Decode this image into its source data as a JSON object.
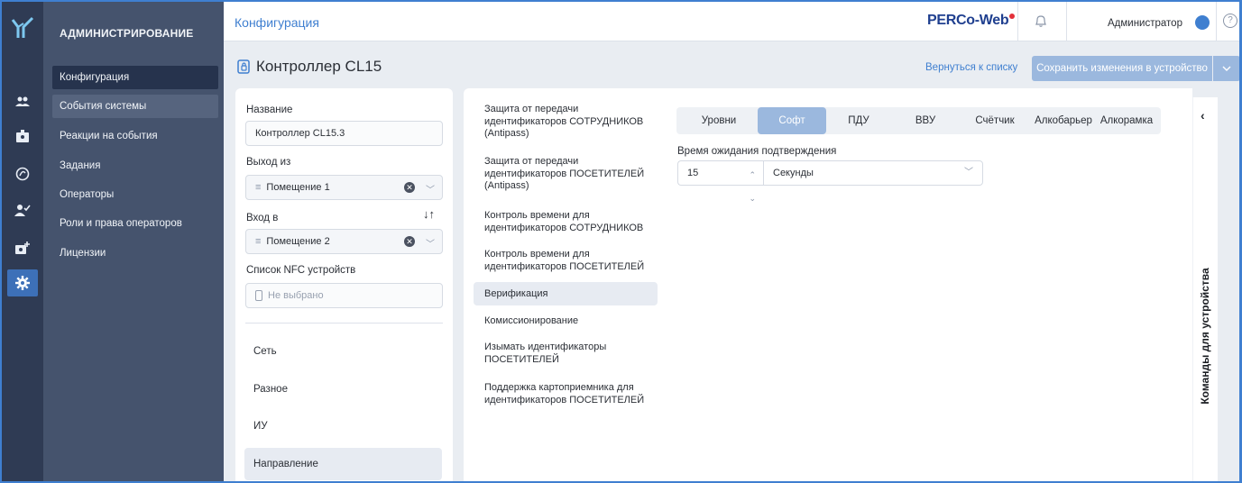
{
  "nav": {
    "section_title": "АДМИНИСТРИРОВАНИЕ",
    "items": [
      {
        "label": "Конфигурация"
      },
      {
        "label": "События системы"
      },
      {
        "label": "Реакции на события"
      },
      {
        "label": "Задания"
      },
      {
        "label": "Операторы"
      },
      {
        "label": "Роли и права операторов"
      },
      {
        "label": "Лицензии"
      }
    ]
  },
  "rail": {
    "icons": [
      "users-icon",
      "badge-icon",
      "fingerprint-icon",
      "user-check-icon",
      "add-badge-icon",
      "gear-icon"
    ]
  },
  "topbar": {
    "breadcrumb": "Конфигурация",
    "brand": "PERCo-Web",
    "user": "Администратор",
    "help": "?"
  },
  "header": {
    "title": "Контроллер CL15",
    "back_link": "Вернуться к списку",
    "save_button": "Сохранить изменения в устройство"
  },
  "form": {
    "name_label": "Название",
    "name_value": "Контроллер CL15.3",
    "exit_label": "Выход из",
    "exit_value": "Помещение 1",
    "entry_label": "Вход в",
    "entry_value": "Помещение 2",
    "nfc_label": "Список NFC устройств",
    "nfc_placeholder": "Не выбрано",
    "sections": [
      {
        "label": "Сеть"
      },
      {
        "label": "Разное"
      },
      {
        "label": "ИУ"
      },
      {
        "label": "Направление"
      }
    ]
  },
  "list": {
    "items": [
      {
        "label": "Защита от передачи идентификаторов СОТРУДНИКОВ (Antipass)"
      },
      {
        "label": "Защита от передачи идентификаторов ПОСЕТИТЕЛЕЙ (Antipass)"
      },
      {
        "label": "Контроль времени для идентификаторов СОТРУДНИКОВ"
      },
      {
        "label": "Контроль времени для идентификаторов ПОСЕТИТЕЛЕЙ"
      },
      {
        "label": "Верификация"
      },
      {
        "label": "Комиссионирование"
      },
      {
        "label": "Изымать идентификаторы ПОСЕТИТЕЛЕЙ"
      },
      {
        "label": "Поддержка картоприемника для идентификаторов ПОСЕТИТЕЛЕЙ"
      }
    ]
  },
  "tabs": [
    {
      "label": "Уровни"
    },
    {
      "label": "Софт"
    },
    {
      "label": "ПДУ"
    },
    {
      "label": "ВВУ"
    },
    {
      "label": "Счётчик"
    },
    {
      "label": "Алкобарьер"
    },
    {
      "label": "Алкорамка"
    }
  ],
  "verification": {
    "wait_label": "Время ожидания подтверждения",
    "wait_value": "15",
    "unit_value": "Секунды"
  },
  "side_panel": {
    "title": "Команды для устройства"
  },
  "colors": {
    "accent": "#3f7fd0",
    "rail": "#2f3b54",
    "nav": "#45536d",
    "active_tab": "#9bb8de",
    "brand_dot": "#e3303a"
  }
}
